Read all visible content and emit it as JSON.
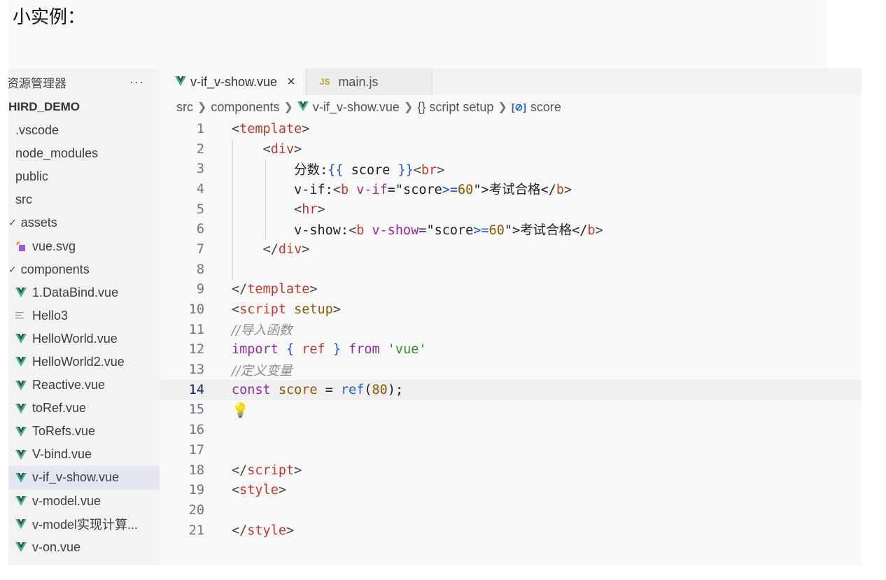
{
  "page": {
    "heading": "小实例："
  },
  "sidebar": {
    "title": "资源管理器",
    "more": "···",
    "project": "HIRD_DEMO",
    "items": [
      {
        "label": ".vscode",
        "kind": "folder"
      },
      {
        "label": "node_modules",
        "kind": "folder"
      },
      {
        "label": "public",
        "kind": "folder"
      },
      {
        "label": "src",
        "kind": "folder"
      },
      {
        "label": "assets",
        "kind": "open-folder"
      },
      {
        "label": "vue.svg",
        "kind": "svg"
      },
      {
        "label": "components",
        "kind": "open-folder"
      },
      {
        "label": "1.DataBind.vue",
        "kind": "vue"
      },
      {
        "label": "Hello3",
        "kind": "text"
      },
      {
        "label": "HelloWorld.vue",
        "kind": "vue"
      },
      {
        "label": "HelloWorld2.vue",
        "kind": "vue"
      },
      {
        "label": "Reactive.vue",
        "kind": "vue"
      },
      {
        "label": "toRef.vue",
        "kind": "vue"
      },
      {
        "label": "ToRefs.vue",
        "kind": "vue"
      },
      {
        "label": "V-bind.vue",
        "kind": "vue"
      },
      {
        "label": "v-if_v-show.vue",
        "kind": "vue",
        "selected": true
      },
      {
        "label": "v-model.vue",
        "kind": "vue"
      },
      {
        "label": "v-model实现计算...",
        "kind": "vue"
      },
      {
        "label": "v-on.vue",
        "kind": "vue"
      }
    ]
  },
  "tabs": [
    {
      "label": "v-if_v-show.vue",
      "active": true,
      "close": "×"
    },
    {
      "label": "main.js",
      "active": false,
      "badge": "JS"
    }
  ],
  "breadcrumb": {
    "src": "src",
    "components": "components",
    "file": "v-if_v-show.vue",
    "script": "{} script setup",
    "symbol_icon": "[⊘]",
    "symbol": "score"
  },
  "editor": {
    "current_line": 14,
    "lines": [
      {
        "n": "1",
        "tokens": [
          [
            "t-bracket",
            "<"
          ],
          [
            "t-tag",
            "template"
          ],
          [
            "t-bracket",
            ">"
          ]
        ]
      },
      {
        "n": "2",
        "tokens": [
          [
            "t-plain",
            "    "
          ],
          [
            "t-bracket",
            "<"
          ],
          [
            "t-tag",
            "div"
          ],
          [
            "t-bracket",
            ">"
          ]
        ]
      },
      {
        "n": "3",
        "tokens": [
          [
            "t-plain",
            "        分数:"
          ],
          [
            "t-brace",
            "{{"
          ],
          [
            "t-plain",
            " score "
          ],
          [
            "t-brace",
            "}}"
          ],
          [
            "t-bracket",
            "<"
          ],
          [
            "t-tag",
            "br"
          ],
          [
            "t-bracket",
            ">"
          ]
        ]
      },
      {
        "n": "4",
        "tokens": [
          [
            "t-plain",
            "        v-if:"
          ],
          [
            "t-bracket",
            "<"
          ],
          [
            "t-tag",
            "b"
          ],
          [
            "t-plain",
            " "
          ],
          [
            "t-attr",
            "v-if"
          ],
          [
            "t-plain",
            "=\"score"
          ],
          [
            "t-brace",
            ">="
          ],
          [
            "t-num",
            "60"
          ],
          [
            "t-plain",
            "\">考试合格</"
          ],
          [
            "t-tag",
            "b"
          ],
          [
            "t-bracket",
            ">"
          ]
        ]
      },
      {
        "n": "5",
        "tokens": [
          [
            "t-plain",
            "        "
          ],
          [
            "t-bracket",
            "<"
          ],
          [
            "t-tag",
            "hr"
          ],
          [
            "t-bracket",
            ">"
          ]
        ]
      },
      {
        "n": "6",
        "tokens": [
          [
            "t-plain",
            "        v-show:"
          ],
          [
            "t-bracket",
            "<"
          ],
          [
            "t-tag",
            "b"
          ],
          [
            "t-plain",
            " "
          ],
          [
            "t-attr",
            "v-show"
          ],
          [
            "t-plain",
            "=\"score"
          ],
          [
            "t-brace",
            ">="
          ],
          [
            "t-num",
            "60"
          ],
          [
            "t-plain",
            "\">考试合格</"
          ],
          [
            "t-tag",
            "b"
          ],
          [
            "t-bracket",
            ">"
          ]
        ]
      },
      {
        "n": "7",
        "tokens": [
          [
            "t-plain",
            "    "
          ],
          [
            "t-bracket",
            "</"
          ],
          [
            "t-tag",
            "div"
          ],
          [
            "t-bracket",
            ">"
          ]
        ]
      },
      {
        "n": "8",
        "tokens": []
      },
      {
        "n": "9",
        "tokens": [
          [
            "t-bracket",
            "</"
          ],
          [
            "t-tag",
            "template"
          ],
          [
            "t-bracket",
            ">"
          ]
        ]
      },
      {
        "n": "10",
        "tokens": [
          [
            "t-bracket",
            "<"
          ],
          [
            "t-tag",
            "script"
          ],
          [
            "t-plain",
            " "
          ],
          [
            "t-var",
            "setup"
          ],
          [
            "t-bracket",
            ">"
          ]
        ]
      },
      {
        "n": "11",
        "tokens": [
          [
            "t-comment",
            "//导入函数"
          ]
        ]
      },
      {
        "n": "12",
        "tokens": [
          [
            "t-kw",
            "import"
          ],
          [
            "t-plain",
            " "
          ],
          [
            "t-brace",
            "{"
          ],
          [
            "t-plain",
            " "
          ],
          [
            "t-tag",
            "ref"
          ],
          [
            "t-plain",
            " "
          ],
          [
            "t-brace",
            "}"
          ],
          [
            "t-plain",
            " "
          ],
          [
            "t-kw",
            "from"
          ],
          [
            "t-plain",
            " "
          ],
          [
            "t-str",
            "'vue'"
          ]
        ]
      },
      {
        "n": "13",
        "tokens": [
          [
            "t-comment",
            "//定义变量"
          ]
        ]
      },
      {
        "n": "14",
        "tokens": [
          [
            "t-kw",
            "const"
          ],
          [
            "t-plain",
            " "
          ],
          [
            "t-var",
            "score"
          ],
          [
            "t-plain",
            " = "
          ],
          [
            "t-fn",
            "ref"
          ],
          [
            "t-plain",
            "("
          ],
          [
            "t-num",
            "80"
          ],
          [
            "t-plain",
            ");"
          ]
        ]
      },
      {
        "n": "15",
        "tokens": [
          [
            "bulb",
            "💡"
          ]
        ]
      },
      {
        "n": "16",
        "tokens": []
      },
      {
        "n": "17",
        "tokens": []
      },
      {
        "n": "18",
        "tokens": [
          [
            "t-bracket",
            "</"
          ],
          [
            "t-tag",
            "script"
          ],
          [
            "t-bracket",
            ">"
          ]
        ]
      },
      {
        "n": "19",
        "tokens": [
          [
            "t-bracket",
            "<"
          ],
          [
            "t-tag",
            "style"
          ],
          [
            "t-bracket",
            ">"
          ]
        ]
      },
      {
        "n": "20",
        "tokens": []
      },
      {
        "n": "21",
        "tokens": [
          [
            "t-bracket",
            "</"
          ],
          [
            "t-tag",
            "style"
          ],
          [
            "t-bracket",
            ">"
          ]
        ]
      }
    ]
  },
  "colors": {
    "vue": "#41b883",
    "vue_dark": "#34495e",
    "svg_icon": "#a05ad8",
    "highlight_line": "#efefef",
    "selected_item": "#e4e6f1"
  }
}
